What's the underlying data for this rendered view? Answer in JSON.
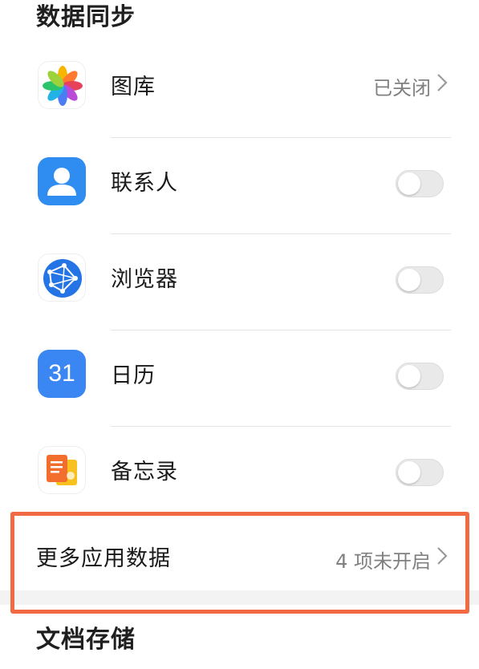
{
  "sections": {
    "sync_title": "数据同步",
    "docs_title": "文档存储"
  },
  "items": [
    {
      "label": "图库",
      "icon": "gallery-flower-icon",
      "status": "已关闭",
      "type": "link"
    },
    {
      "label": "联系人",
      "icon": "contacts-person-icon",
      "state": "off",
      "type": "toggle"
    },
    {
      "label": "浏览器",
      "icon": "browser-globe-icon",
      "state": "off",
      "type": "toggle"
    },
    {
      "label": "日历",
      "icon": "calendar-icon",
      "icon_text": "31",
      "state": "off",
      "type": "toggle"
    },
    {
      "label": "备忘录",
      "icon": "notepad-icon",
      "state": "off",
      "type": "toggle"
    }
  ],
  "more": {
    "label": "更多应用数据",
    "status": "4 项未开启"
  },
  "colors": {
    "highlight": "#f26a44",
    "toggle_off": "#e9e9e9",
    "calendar_blue": "#3a86f2",
    "contacts_blue": "#2f8cf0",
    "browser_blue": "#2474e6"
  }
}
